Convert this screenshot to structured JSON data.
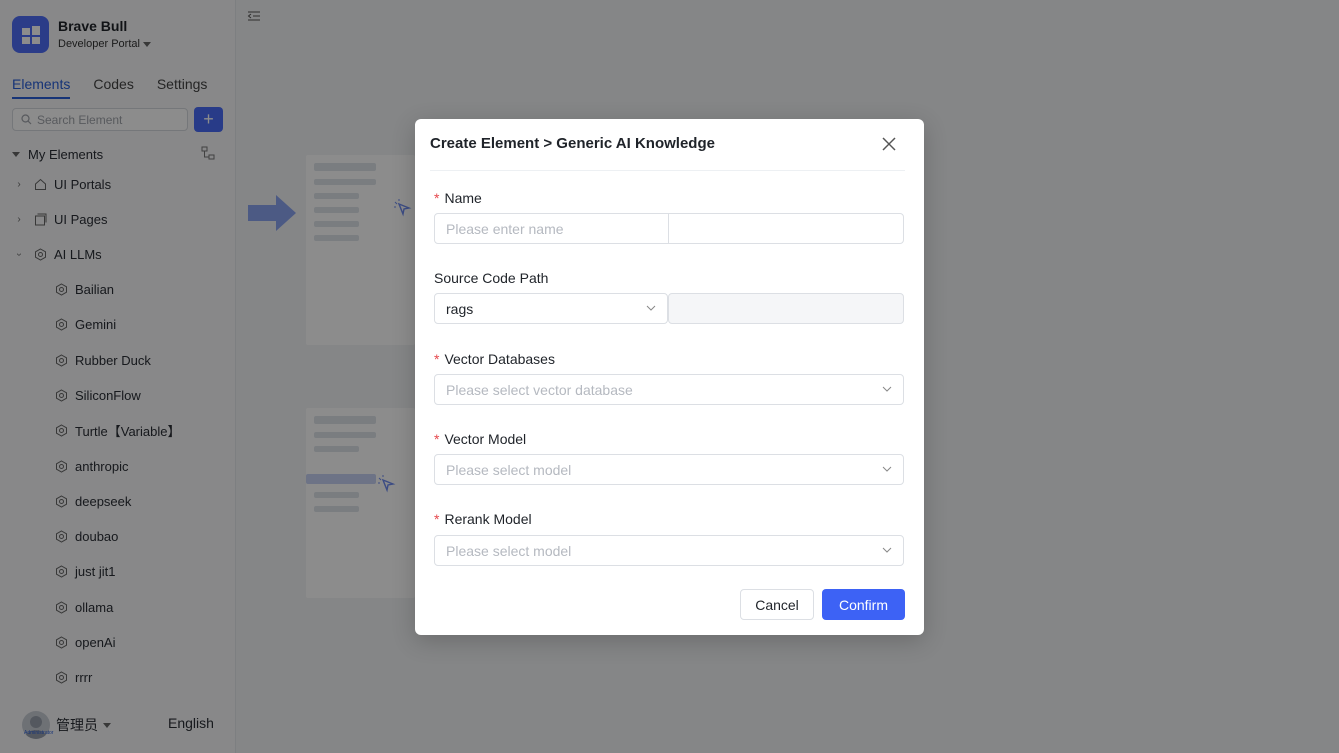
{
  "app": {
    "brand_name": "Brave Bull",
    "portal_label": "Developer Portal"
  },
  "sidebar": {
    "tabs": [
      {
        "label": "Elements",
        "active": true
      },
      {
        "label": "Codes",
        "active": false
      },
      {
        "label": "Settings",
        "active": false
      }
    ],
    "search_placeholder": "Search Element",
    "add_label": "+",
    "section_label": "My Elements",
    "tree": [
      {
        "label": "UI Portals",
        "icon": "home-icon",
        "expanded": false
      },
      {
        "label": "UI Pages",
        "icon": "pages-icon",
        "expanded": false
      },
      {
        "label": "AI LLMs",
        "icon": "llm-icon",
        "expanded": true
      },
      {
        "label": "Bailian",
        "icon": "llm-icon"
      },
      {
        "label": "Gemini",
        "icon": "llm-icon"
      },
      {
        "label": "Rubber Duck",
        "icon": "llm-icon"
      },
      {
        "label": "SiliconFlow",
        "icon": "llm-icon"
      },
      {
        "label": "Turtle【Variable】",
        "icon": "llm-icon"
      },
      {
        "label": "anthropic",
        "icon": "llm-icon"
      },
      {
        "label": "deepseek",
        "icon": "llm-icon"
      },
      {
        "label": "doubao",
        "icon": "llm-icon"
      },
      {
        "label": "just jit1",
        "icon": "llm-icon"
      },
      {
        "label": "ollama",
        "icon": "llm-icon"
      },
      {
        "label": "openAi",
        "icon": "llm-icon"
      },
      {
        "label": "rrrr",
        "icon": "llm-icon"
      }
    ],
    "footer": {
      "user_name": "管理员",
      "avatar_caption": "Administrator",
      "language": "English"
    }
  },
  "modal": {
    "title": "Create Element > Generic AI Knowledge",
    "fields": {
      "name": {
        "label": "Name",
        "required": true,
        "placeholder": "Please enter name"
      },
      "source_path": {
        "label": "Source Code Path",
        "required": false,
        "value": "rags"
      },
      "vector_db": {
        "label": "Vector Databases",
        "required": true,
        "placeholder": "Please select vector database"
      },
      "vector_model": {
        "label": "Vector Model",
        "required": true,
        "placeholder": "Please select model"
      },
      "rerank_model": {
        "label": "Rerank Model",
        "required": true,
        "placeholder": "Please select model"
      }
    },
    "cancel_label": "Cancel",
    "confirm_label": "Confirm"
  },
  "colors": {
    "accent": "#3d62f5",
    "required": "#e5484d",
    "overlay": "rgba(0,0,0,0.45)"
  }
}
